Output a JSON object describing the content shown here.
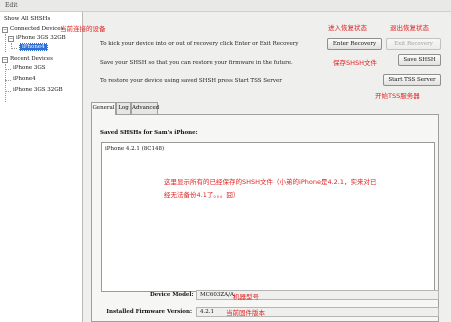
{
  "window": {
    "title": "Edit"
  },
  "tree": {
    "show_all": "Show All SHSHs",
    "connected_header": "Connected Devices",
    "connected_device": "iPhone 3GS 32GB",
    "connected_child": "iPhone4",
    "recent_header": "Recent Devices",
    "recent_items": [
      "iPhone 3GS",
      "iPhone4",
      "iPhone 3GS 32GB"
    ]
  },
  "annotations": {
    "current_device": "当前连接的设备",
    "enter_recovery": "进入恢复状态",
    "exit_recovery": "退出恢复状态",
    "save_shsh": "保存SHSH文件",
    "start_tss": "开始TSS服务器",
    "list_note_line1": "这里显示所有的已经保存的SHSH文件（小弟的iPhone是4.2.1，实来对已",
    "list_note_line2": "经无法备份4.1了。。。囧）",
    "model_note": "机器型号",
    "firmware_note": "当前固件版本"
  },
  "actions": {
    "recovery_text": "To kick your device into or out of recovery click Enter or Exit Recovery",
    "enter_recovery": "Enter Recovery",
    "exit_recovery": "Exit Recovery",
    "shsh_text": "Save your SHSH so that you can restore your firmware in the future.",
    "save_shsh": "Save SHSH",
    "tss_text": "To restore your device using saved SHSH press Start TSS Server",
    "start_tss": "Start TSS Server"
  },
  "tabs": [
    "General",
    "Log",
    "Advanced"
  ],
  "general": {
    "saved_title": "Saved SHSHs for Sam's iPhone:",
    "saved_items": [
      "iPhone 4.2.1 (8C148)"
    ],
    "device_model_label": "Device Model:",
    "device_model_value": "MC603ZA/A",
    "firmware_label": "Installed Firmware Version:",
    "firmware_value": "4.2.1"
  }
}
